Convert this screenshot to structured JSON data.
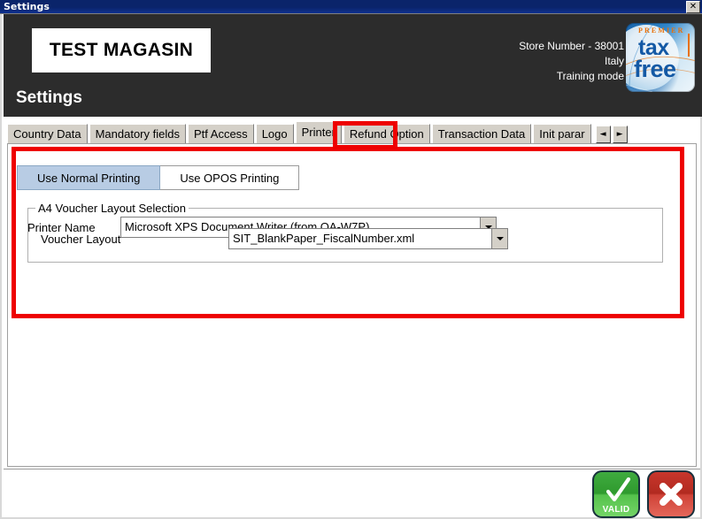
{
  "window": {
    "title": "Settings",
    "close_icon": "close-icon",
    "close_glyph": "✕"
  },
  "header": {
    "store_name": "TEST MAGASIN",
    "page_title": "Settings",
    "store_number": "Store Number - 38001",
    "country": "Italy",
    "mode": "Training mode",
    "logo": {
      "premier": "PREMIER",
      "tax": "tax",
      "free": "free"
    },
    "background_color": "#2c2c2c"
  },
  "tabs": {
    "items": [
      {
        "label": "Country Data",
        "selected": false
      },
      {
        "label": "Mandatory fields",
        "selected": false
      },
      {
        "label": "Ptf Access",
        "selected": false
      },
      {
        "label": "Logo",
        "selected": false
      },
      {
        "label": "Printer",
        "selected": true
      },
      {
        "label": "Refund Option",
        "selected": false
      },
      {
        "label": "Transaction Data",
        "selected": false
      },
      {
        "label": "Init parar",
        "selected": false
      }
    ],
    "scroll_left_glyph": "◄",
    "scroll_right_glyph": "►"
  },
  "printer_tab": {
    "subtabs": [
      {
        "label": "Use Normal Printing",
        "active": true
      },
      {
        "label": "Use OPOS Printing",
        "active": false
      }
    ],
    "printer_name": {
      "label": "Printer Name",
      "value": "Microsoft XPS Document Writer (from OA-W7P)"
    },
    "voucher_group": {
      "legend": "A4 Voucher Layout Selection",
      "voucher_layout": {
        "label": "Voucher Layout",
        "value": "SIT_BlankPaper_FiscalNumber.xml"
      }
    }
  },
  "footer": {
    "valid_button_label": "VALID",
    "valid_icon": "check-icon",
    "cancel_icon": "x-icon"
  },
  "annotation": {
    "highlight_color": "#ee0000"
  }
}
